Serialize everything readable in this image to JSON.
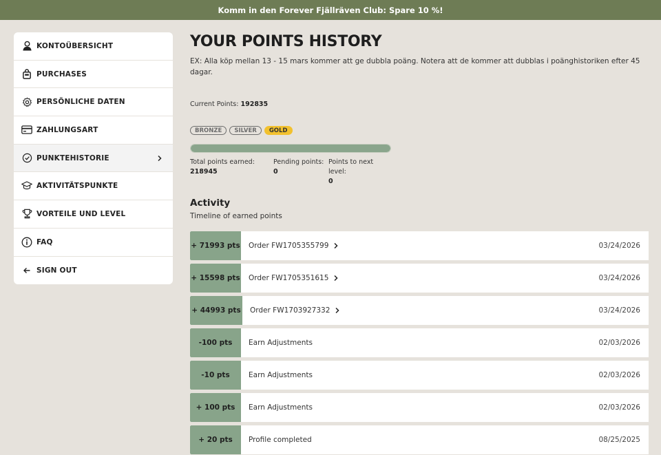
{
  "banner": {
    "text": "Komm in den Forever Fjällräven Club: Spare 10 %!"
  },
  "sidebar": {
    "items": [
      {
        "label": "KONTOÜBERSICHT",
        "icon": "user-icon"
      },
      {
        "label": "PURCHASES",
        "icon": "bag-icon"
      },
      {
        "label": "PERSÖNLICHE DATEN",
        "icon": "gear-icon"
      },
      {
        "label": "ZAHLUNGSART",
        "icon": "card-icon"
      },
      {
        "label": "PUNKTEHISTORIE",
        "icon": "check-circle-icon",
        "active": true
      },
      {
        "label": "AKTIVITÄTSPUNKTE",
        "icon": "graduation-cap-icon"
      },
      {
        "label": "VORTEILE UND LEVEL",
        "icon": "trophy-icon"
      },
      {
        "label": "FAQ",
        "icon": "info-icon"
      },
      {
        "label": "SIGN OUT",
        "icon": "arrow-left-icon"
      }
    ]
  },
  "main": {
    "title": "YOUR POINTS HISTORY",
    "note": "EX: Alla köp mellan 13 - 15 mars kommer att ge dubbla poäng. Notera att de kommer att dubblas i poänghistoriken efter 45 dagar.",
    "current_label": "Current Points:",
    "current_value": "192835",
    "levels": [
      "BRONZE",
      "SILVER",
      "GOLD"
    ],
    "active_level": "GOLD",
    "progress_fraction": 1.0,
    "stats": {
      "earned_label": "Total points earned:",
      "earned_value": "218945",
      "pending_label": "Pending points:",
      "pending_value": "0",
      "next_label": "Points to next level:",
      "next_value": "0"
    },
    "activity_title": "Activity",
    "activity_sub": "Timeline of earned points"
  },
  "activity": [
    {
      "pts": "+ 71993 pts",
      "desc": "Order FW1705355799",
      "date": "03/24/2026",
      "link": true
    },
    {
      "pts": "+ 15598 pts",
      "desc": "Order FW1705351615",
      "date": "03/24/2026",
      "link": true
    },
    {
      "pts": "+ 44993 pts",
      "desc": "Order FW1703927332",
      "date": "03/24/2026",
      "link": true
    },
    {
      "pts": "-100 pts",
      "desc": "Earn Adjustments",
      "date": "02/03/2026",
      "link": false
    },
    {
      "pts": "-10 pts",
      "desc": "Earn Adjustments",
      "date": "02/03/2026",
      "link": false
    },
    {
      "pts": "+ 100 pts",
      "desc": "Earn Adjustments",
      "date": "02/03/2026",
      "link": false
    },
    {
      "pts": "+ 20 pts",
      "desc": "Profile completed",
      "date": "08/25/2025",
      "link": false
    }
  ],
  "colors": {
    "banner": "#6e7c55",
    "points_tag": "#88a48a",
    "gold_badge": "#f2c12e",
    "background": "#e6e2dc"
  }
}
